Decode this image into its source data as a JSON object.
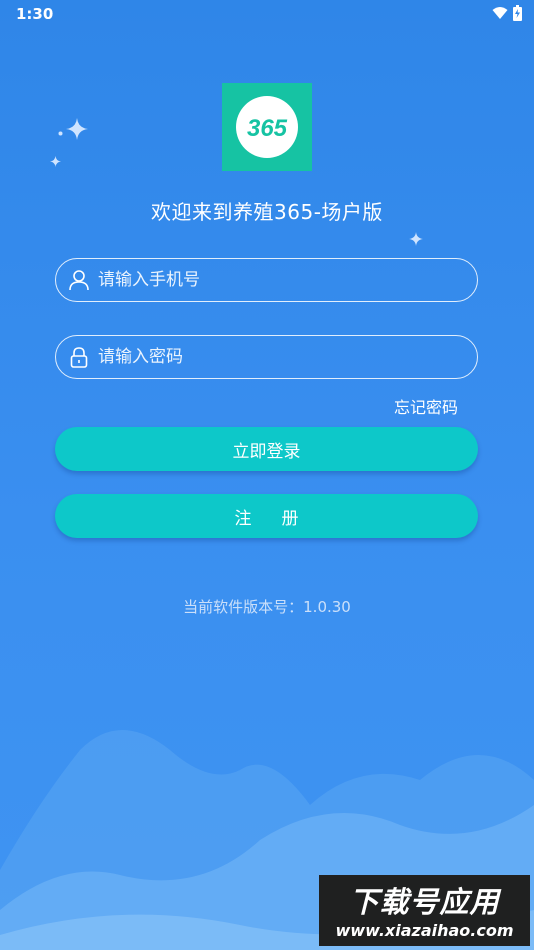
{
  "status_bar": {
    "time": "1:30"
  },
  "app": {
    "welcome_text": "欢迎来到养殖365-场户版",
    "logo_text": "365"
  },
  "form": {
    "phone_placeholder": "请输入手机号",
    "password_placeholder": "请输入密码",
    "forgot_password": "忘记密码",
    "login_button": "立即登录",
    "register_button": "注册"
  },
  "footer": {
    "version_text": "当前软件版本号：1.0.30"
  },
  "watermark": {
    "title": "下载号应用",
    "url": "www.xiazaihao.com"
  },
  "colors": {
    "accent": "#0dc8c9",
    "logo_bg": "#16c3a3",
    "background": "#2f86e8"
  }
}
